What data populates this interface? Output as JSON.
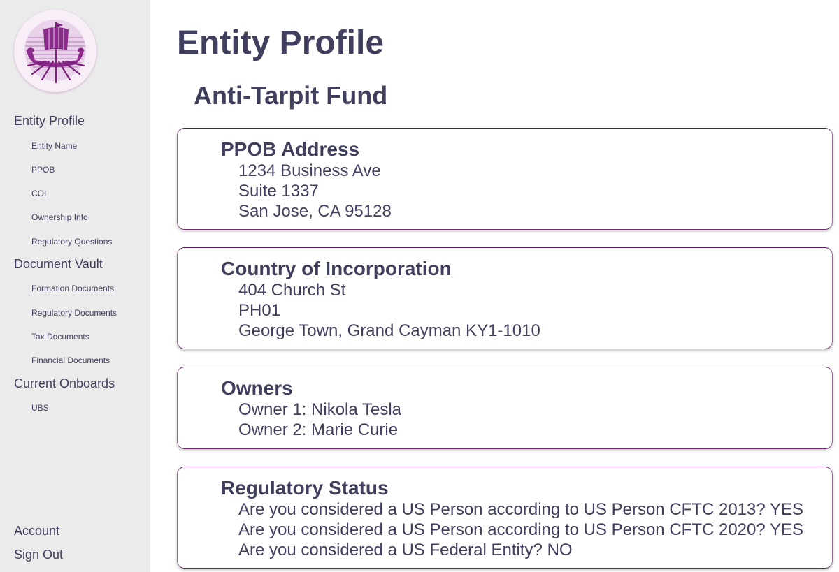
{
  "sidebar": {
    "logo": "viking-ship-logo",
    "sections": [
      {
        "label": "Entity Profile",
        "items": [
          "Entity Name",
          "PPOB",
          "COI",
          "Ownership Info",
          "Regulatory Questions"
        ]
      },
      {
        "label": "Document Vault",
        "items": [
          "Formation Documents",
          "Regulatory Documents",
          "Tax Documents",
          "Financial Documents"
        ]
      },
      {
        "label": "Current Onboards",
        "items": [
          "UBS"
        ]
      }
    ],
    "footer": {
      "account": "Account",
      "sign_out": "Sign Out"
    }
  },
  "main": {
    "title": "Entity Profile",
    "entity_name": "Anti-Tarpit Fund",
    "cards": [
      {
        "title": "PPOB Address",
        "lines": [
          "1234 Business Ave",
          "Suite 1337",
          "San Jose, CA 95128"
        ]
      },
      {
        "title": "Country of Incorporation",
        "lines": [
          "404 Church St",
          "PH01",
          "George Town, Grand Cayman KY1-1010"
        ]
      },
      {
        "title": "Owners",
        "lines": [
          "Owner 1: Nikola Tesla",
          "Owner 2: Marie Curie"
        ]
      },
      {
        "title": "Regulatory Status",
        "lines": [
          "Are you considered a US Person according to US Person CFTC 2013? YES",
          "Are you considered a US Person according to US Person CFTC 2020? YES",
          "Are you considered a US Federal Entity? NO"
        ]
      }
    ]
  },
  "colors": {
    "text": "#40405e",
    "sidebar_bg": "#ebebeb",
    "card_border": "#5a1a5a",
    "logo_purple": "#8a2a8a"
  }
}
